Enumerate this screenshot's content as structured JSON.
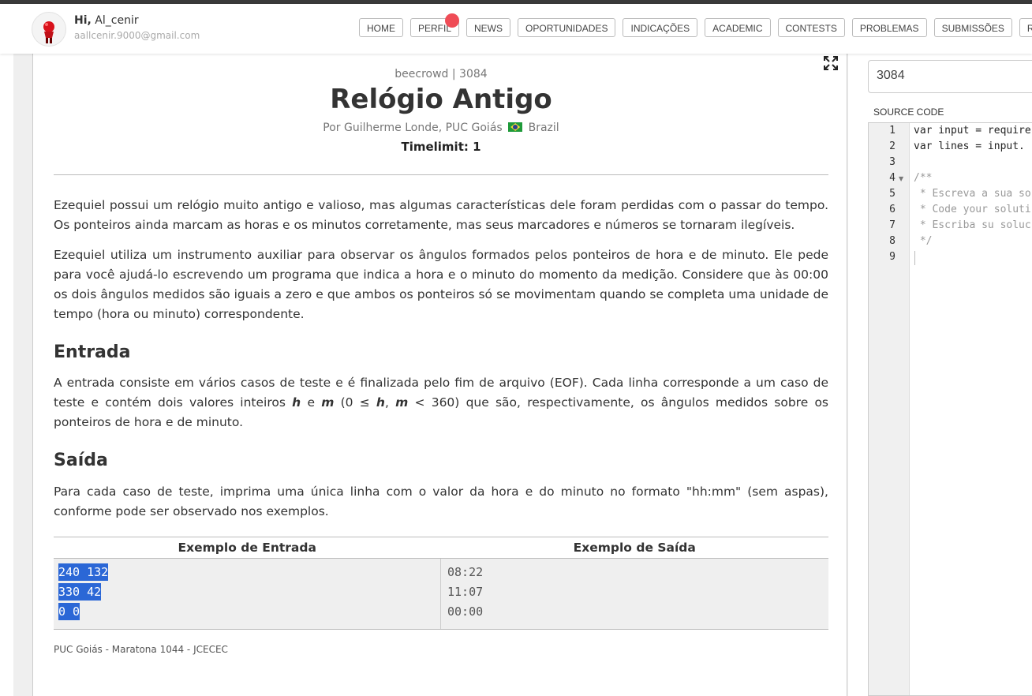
{
  "header": {
    "greeting_prefix": "Hi,",
    "username": "Al_cenir",
    "email": "aallcenir.9000@gmail.com",
    "nav": [
      "HOME",
      "PERFIL",
      "NEWS",
      "OPORTUNIDADES",
      "INDICAÇÕES",
      "ACADEMIC",
      "CONTESTS",
      "PROBLEMAS",
      "SUBMISSÕES",
      "RANKS"
    ],
    "notification_color": "#ef4c56"
  },
  "problem": {
    "source": "beecrowd | 3084",
    "title": "Relógio Antigo",
    "author_prefix": "Por Guilherme Londe, PUC Goiás",
    "country": "Brazil",
    "timelimit": "Timelimit: 1",
    "description": [
      "Ezequiel possui um relógio muito antigo e valioso, mas algumas características dele foram perdidas com o passar do tempo. Os ponteiros ainda marcam as horas e os minutos corretamente, mas seus marcadores e números se tornaram ilegíveis.",
      "Ezequiel utiliza um instrumento auxiliar para observar os ângulos formados pelos ponteiros de hora e de minuto. Ele pede para você ajudá-lo escrevendo um programa que indica a hora e o minuto do momento da medição. Considere que às 00:00 os dois ângulos medidos são iguais a zero e que ambos os ponteiros só se movimentam quando se completa uma unidade de tempo (hora ou minuto) correspondente."
    ],
    "input_heading": "Entrada",
    "input_text": {
      "part1": "A entrada consiste em vários casos de teste e é finalizada pelo fim de arquivo (EOF). Cada linha corresponde a um caso de teste e contém dois valores inteiros ",
      "h": "h",
      "e": " e ",
      "m": "m",
      "open": " (0 ≤ ",
      "h2": "h",
      "comma": ", ",
      "m2": "m",
      "part2": " < 360) que são, respectivamente, os ângulos medidos sobre os ponteiros de hora e de minuto."
    },
    "output_heading": "Saída",
    "output_text": "Para cada caso de teste, imprima uma única linha com o valor da hora e do minuto no formato \"hh:mm\" (sem aspas), conforme pode ser observado nos exemplos.",
    "samples": {
      "input_header": "Exemplo de Entrada",
      "output_header": "Exemplo de Saída",
      "input_lines": [
        "240 132",
        "330 42",
        "0 0"
      ],
      "output_lines": [
        "08:22",
        "11:07",
        "00:00"
      ]
    },
    "footer": "PUC Goiás - Maratona 1044 - JCECEC"
  },
  "editor": {
    "problem_id_value": "3084",
    "source_code_label": "SOURCE CODE",
    "line_numbers": [
      "1",
      "2",
      "3",
      "4",
      "5",
      "6",
      "7",
      "8",
      "9"
    ],
    "lines": [
      "var input = require",
      "var lines = input.",
      "",
      "/**",
      " * Escreva a sua so",
      " * Code your soluti",
      " * Escriba su soluc",
      " */",
      ""
    ]
  },
  "colors": {
    "selection": "#2b67d6",
    "sample_bg": "#efefef"
  }
}
